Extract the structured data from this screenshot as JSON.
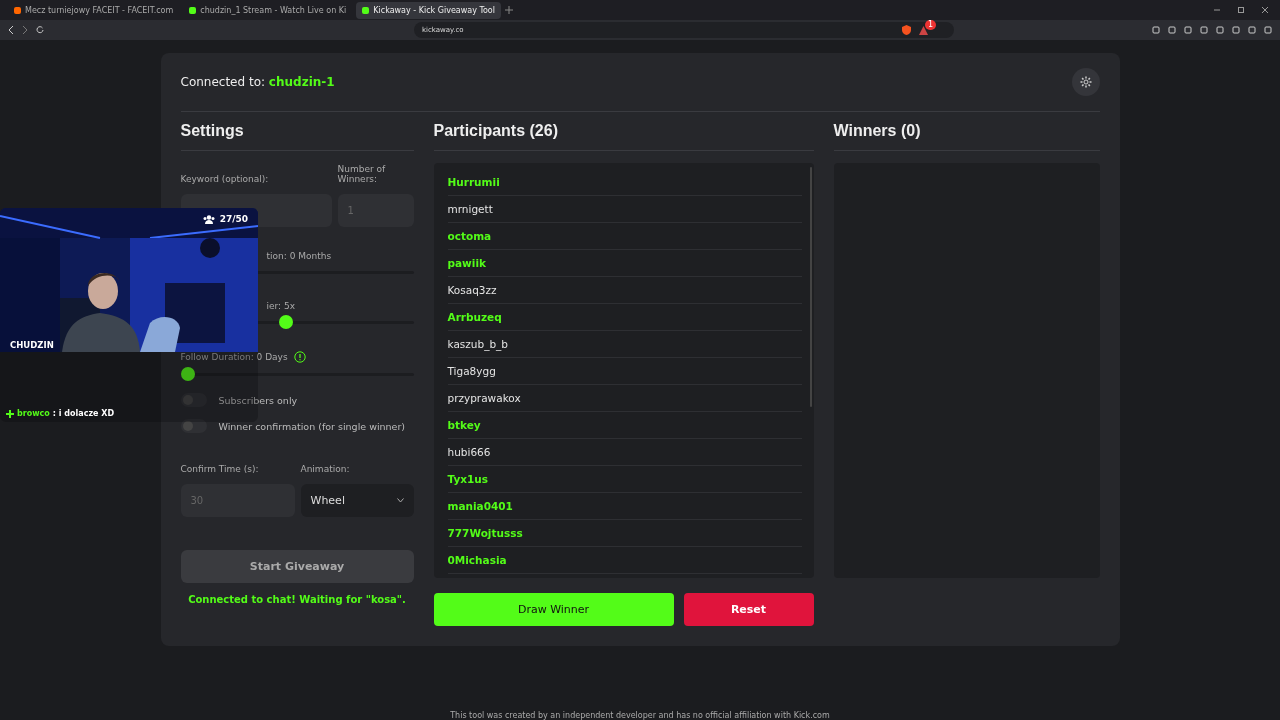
{
  "browser": {
    "tabs": [
      {
        "title": "Mecz turniejowy FACEIT - FACEIT.com",
        "selected": false
      },
      {
        "title": "chudzin_1 Stream - Watch Live on Ki",
        "selected": false
      },
      {
        "title": "Kickaway - Kick Giveaway Tool",
        "selected": true
      }
    ],
    "address": "kickaway.co",
    "notification_count": "1"
  },
  "header": {
    "label": "Connected to:",
    "channel": "chudzin-1"
  },
  "settings": {
    "title": "Settings",
    "keyword_label": "Keyword (optional):",
    "winners_label": "Number of Winners:",
    "winners_placeholder": "1",
    "sliders": [
      {
        "label": "tion: 0 Months",
        "partial": true
      },
      {
        "label": "ier: 5x",
        "partial": true,
        "level": 0.45
      },
      {
        "label": "Follow Duration: 0 Days",
        "partial": false,
        "warning": true,
        "level": 0
      }
    ],
    "toggles": [
      {
        "label": "Subscribers only",
        "on": false
      },
      {
        "label": "Winner confirmation (for single winner)",
        "on": false
      }
    ],
    "confirm_label": "Confirm Time (s):",
    "confirm_placeholder": "30",
    "animation_label": "Animation:",
    "animation_value": "Wheel",
    "start_button": "Start Giveaway",
    "status": "Connected to chat! Waiting for \"kosa\"."
  },
  "participants": {
    "title": "Participants (26)",
    "items": [
      {
        "name": "Hurrumii",
        "color": "#53fc18"
      },
      {
        "name": "mrnigett",
        "color": "#e4e4e4"
      },
      {
        "name": "octoma",
        "color": "#53fc18"
      },
      {
        "name": "pawiik",
        "color": "#53fc18"
      },
      {
        "name": "Kosaq3zz",
        "color": "#e4e4e4"
      },
      {
        "name": "Arrbuzeq",
        "color": "#53fc18"
      },
      {
        "name": "kaszub_b_b",
        "color": "#e4e4e4"
      },
      {
        "name": "Tiga8ygg",
        "color": "#e4e4e4"
      },
      {
        "name": "przyprawakox",
        "color": "#e4e4e4"
      },
      {
        "name": "btkey",
        "color": "#53fc18"
      },
      {
        "name": "hubi666",
        "color": "#e4e4e4"
      },
      {
        "name": "Tyx1us",
        "color": "#53fc18"
      },
      {
        "name": "mania0401",
        "color": "#53fc18"
      },
      {
        "name": "777Wojtusss",
        "color": "#53fc18"
      },
      {
        "name": "0Michasia",
        "color": "#53fc18"
      }
    ],
    "draw_button": "Draw Winner",
    "reset_button": "Reset"
  },
  "winners": {
    "title": "Winners (0)"
  },
  "overlay": {
    "viewers": "27/50",
    "streamer": "CHUDZIN",
    "chat_user": "browco",
    "chat_message": ": i dolacze XD"
  },
  "footer": "This tool was created by an independent developer and has no official affiliation with Kick.com"
}
